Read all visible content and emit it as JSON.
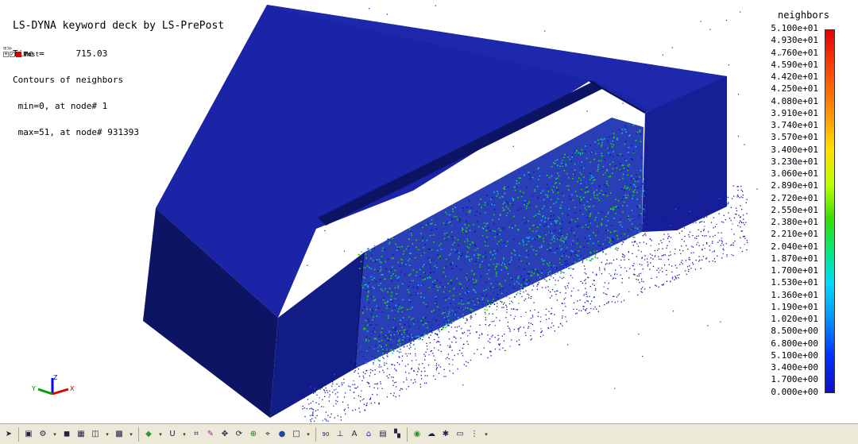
{
  "header": {
    "title": "LS-DYNA keyword deck by LS-PrePost",
    "time_label": "Time =",
    "time_value": "715.03",
    "contour_label": "Contours of neighbors",
    "min_line": "min=0, at node# 1",
    "max_line": "max=51, at node# 931393"
  },
  "model_tree": {
    "label": "Post",
    "color": "#d40000"
  },
  "legend": {
    "title": "neighbors",
    "ticks": [
      "5.100e+01",
      "4.930e+01",
      "4.760e+01",
      "4.590e+01",
      "4.420e+01",
      "4.250e+01",
      "4.080e+01",
      "3.910e+01",
      "3.740e+01",
      "3.570e+01",
      "3.400e+01",
      "3.230e+01",
      "3.060e+01",
      "2.890e+01",
      "2.720e+01",
      "2.550e+01",
      "2.380e+01",
      "2.210e+01",
      "2.040e+01",
      "1.870e+01",
      "1.700e+01",
      "1.530e+01",
      "1.360e+01",
      "1.190e+01",
      "1.020e+01",
      "8.500e+00",
      "6.800e+00",
      "5.100e+00",
      "3.400e+00",
      "1.700e+00",
      "0.000e+00"
    ],
    "colors": {
      "max": "#e8000b",
      "mid": "#34e000",
      "min": "#1010c8"
    }
  },
  "axes": {
    "x": "X",
    "y": "Y",
    "z": "Z"
  },
  "toolbar": {
    "items": [
      "select-arrow-icon",
      "cube-front-icon",
      "gear-icon",
      "dropdown-icon",
      "cube-shaded-icon",
      "cube-wire-icon",
      "cube-edge-icon",
      "dropdown-icon",
      "mesh-icon",
      "dropdown-icon",
      "iso-view-icon",
      "dropdown-icon",
      "u-icon",
      "dropdown-icon",
      "tag-icon",
      "brush-icon",
      "move-icon",
      "rotate-icon",
      "zoom-icon",
      "pan-icon",
      "sphere-icon",
      "cube-outline-icon",
      "dropdown-icon",
      "number-90-icon",
      "axis-icon",
      "label-icon",
      "home-icon",
      "grid-icon",
      "checker-icon",
      "green-ball-icon",
      "cloud-icon",
      "settings-icon",
      "screen-icon",
      "tree-icon",
      "dropdown-icon"
    ],
    "zoom_label": "90"
  }
}
